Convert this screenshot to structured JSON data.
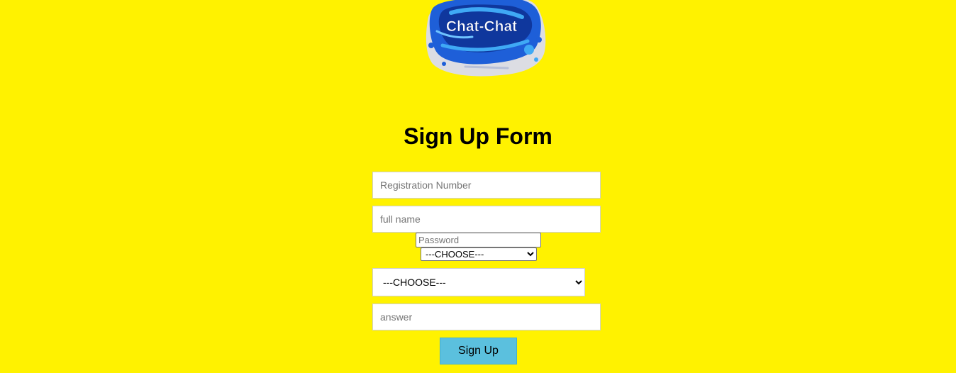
{
  "logo": {
    "text": "Chat-Chat",
    "colors": {
      "primary": "#1e5fd8",
      "dark": "#0b2a8a",
      "light": "#3fa9f5"
    }
  },
  "form": {
    "title": "Sign Up Form",
    "registration_placeholder": "Registration Number",
    "fullname_placeholder": "full name",
    "password_placeholder": "Password",
    "select_small": {
      "selected": "---CHOOSE---"
    },
    "select_big": {
      "selected": "---CHOOSE---"
    },
    "answer_placeholder": "answer",
    "submit_label": "Sign Up"
  },
  "colors": {
    "background": "#fff200",
    "button": "#5bc0de"
  }
}
